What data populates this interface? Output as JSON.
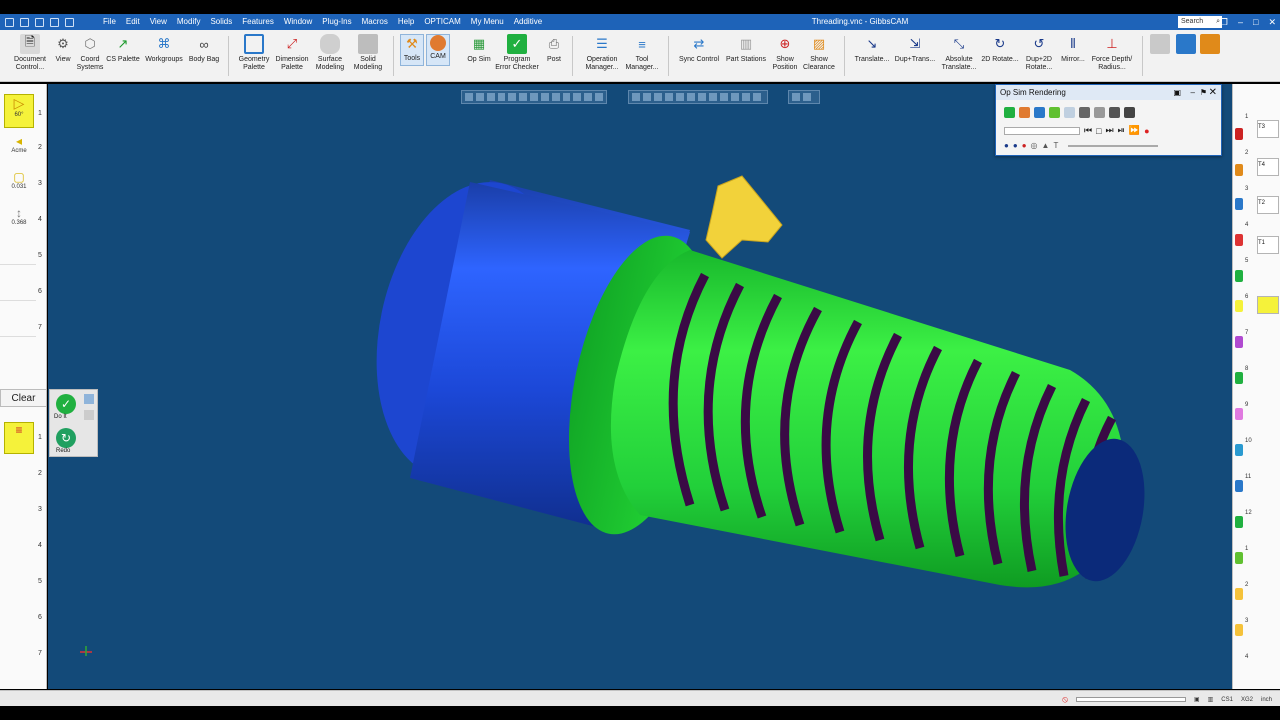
{
  "window": {
    "title": "Threading.vnc - GibbsCAM",
    "search_label": "Search"
  },
  "menu": [
    "File",
    "Edit",
    "View",
    "Modify",
    "Solids",
    "Features",
    "Window",
    "Plug-Ins",
    "Macros",
    "Help",
    "OPTICAM",
    "My Menu",
    "Additive"
  ],
  "ribbon": {
    "document_control": "Document\nControl...",
    "view": "View",
    "coord_systems": "Coord\nSystems",
    "cs_palette": "CS Palette",
    "workgroups": "Workgroups",
    "body_bag": "Body Bag",
    "geometry_palette": "Geometry\nPalette",
    "dimension_palette": "Dimension\nPalette",
    "surface_modeling": "Surface\nModeling",
    "solid_modeling": "Solid\nModeling",
    "tools": "Tools",
    "cam": "CAM",
    "op_sim": "Op Sim",
    "program_error_checker": "Program\nError Checker",
    "post": "Post",
    "operation_manager": "Operation\nManager...",
    "tool_manager": "Tool\nManager...",
    "sync_control": "Sync Control",
    "part_stations": "Part Stations",
    "show_position": "Show\nPosition",
    "show_clearance": "Show\nClearance",
    "translate": "Translate...",
    "dup_translate": "Dup+Trans...",
    "absolute_translate": "Absolute\nTranslate...",
    "rotate_2d": "2D Rotate...",
    "dup_rotate_2d": "Dup+2D\nRotate...",
    "mirror": "Mirror...",
    "force_depth": "Force Depth/\nRadius..."
  },
  "left_palette": {
    "tool1_label": "60°",
    "tool2_label": "Acme",
    "tool3_value": "0.031",
    "tool4_value": "0.368",
    "slot_numbers": [
      "1",
      "2",
      "3",
      "4",
      "5",
      "6",
      "7"
    ],
    "clear_label": "Clear",
    "do_it_label": "Do It",
    "redo_label": "Redo",
    "process_numbers": [
      "1",
      "2",
      "3",
      "4",
      "5",
      "6",
      "7"
    ]
  },
  "op_sim_panel": {
    "title": "Op Sim Rendering"
  },
  "right_palette": {
    "ops": [
      "T3",
      "T4",
      "T2",
      "T1"
    ],
    "numbers": [
      "1",
      "2",
      "3",
      "4",
      "5",
      "6",
      "7",
      "8",
      "9",
      "10",
      "11",
      "12",
      "1",
      "2",
      "3",
      "4"
    ]
  },
  "status_bar": {
    "cs_label": "CS1",
    "cs2_label": "XG2",
    "units": "inch"
  },
  "colors": {
    "viewport_bg": "#134a79",
    "stock_blue": "#1f4fd6",
    "part_green": "#20d83a",
    "thread_purple": "#3a0a45",
    "tool_yellow": "#f2d23a",
    "title_bar": "#1e63b8"
  }
}
